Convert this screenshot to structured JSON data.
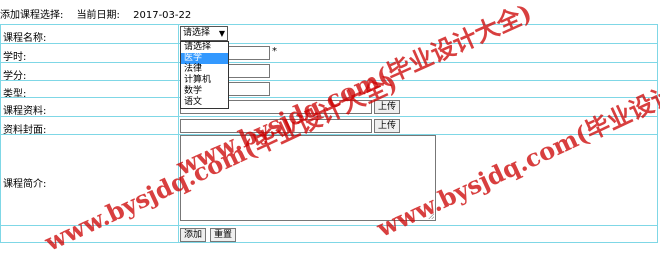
{
  "header": {
    "page_label": "添加课程选择:",
    "date_label": "当前日期:",
    "date_value": "2017-03-22"
  },
  "form": {
    "rows": {
      "course_name": "课程名称:",
      "credit_hours": "学时:",
      "credits": "学分:",
      "type": "类型:",
      "course_material": "课程资料:",
      "cover": "资料封面:",
      "intro": "课程简介:"
    },
    "course_select": {
      "selected": "请选择",
      "options": [
        "请选择",
        "医学",
        "法律",
        "计算机",
        "数学",
        "语文"
      ],
      "highlighted_index": 1
    },
    "required_mark": "*",
    "upload_label": "上传",
    "upload_label_cover": "上传",
    "add_button": "添加",
    "reset_button": "重置"
  },
  "watermarks": {
    "top": "www.bysjdq.com(毕业设计大全)",
    "bottom": "www.bysjdq.com(毕业设计大全)",
    "right": "www.bysjdq.com(毕业设计大全)"
  }
}
